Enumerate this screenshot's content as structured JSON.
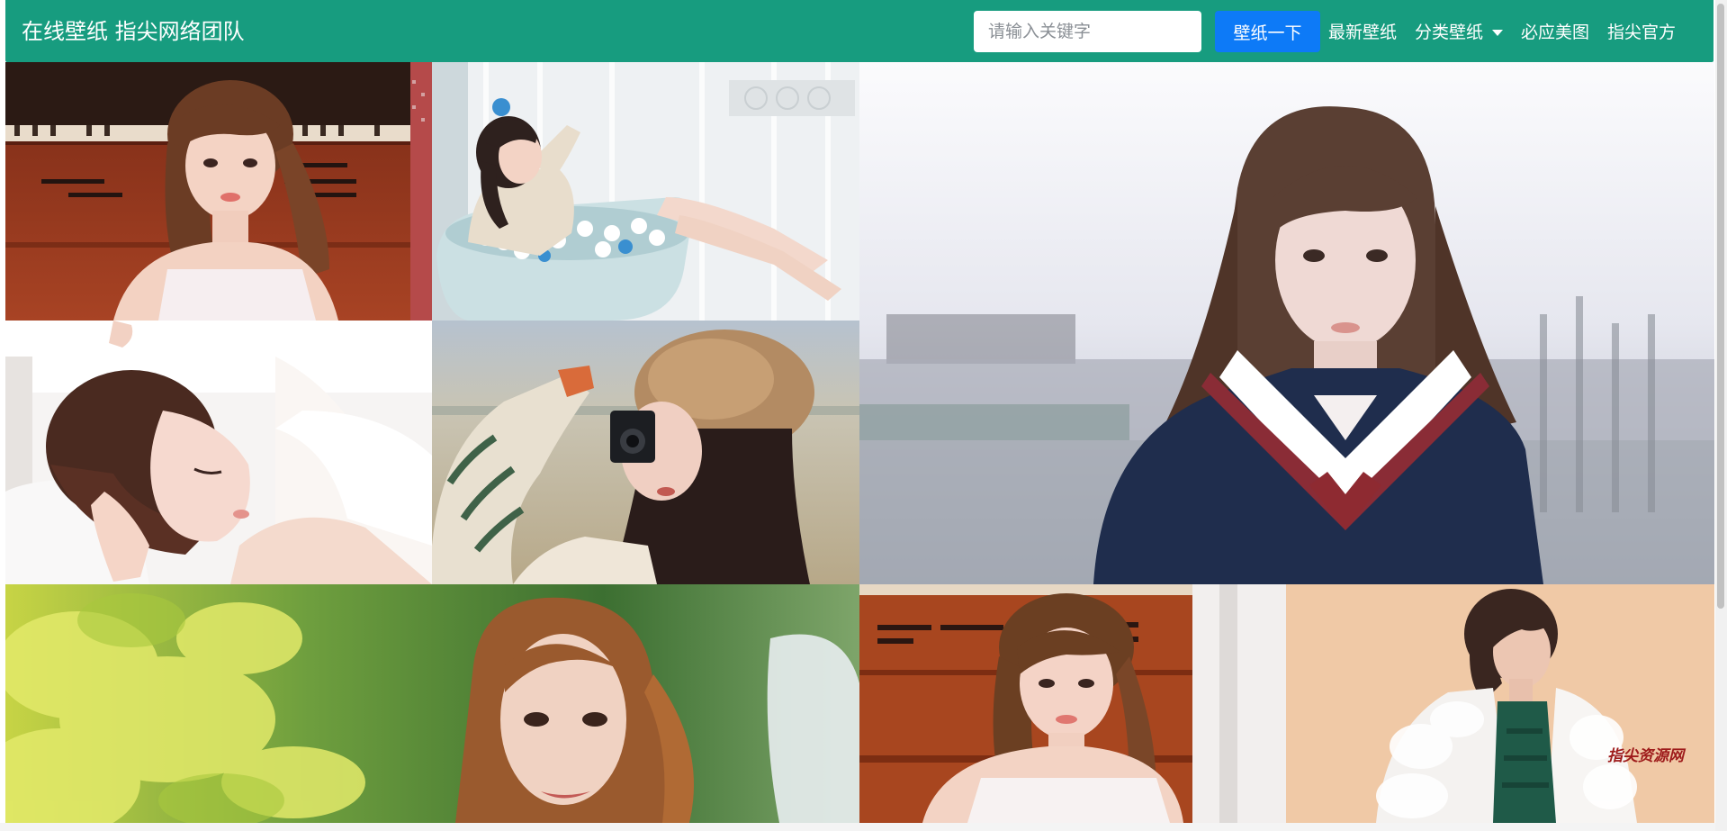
{
  "navbar": {
    "brand": "在线壁纸 指尖网络团队",
    "search_placeholder": "请输入关键字",
    "search_button": "壁纸一下",
    "links": {
      "latest": "最新壁纸",
      "category": "分类壁纸",
      "bing": "必应美图",
      "official": "指尖官方"
    },
    "color": "#179c7f",
    "button_color": "#0d7af7"
  },
  "gallery": {
    "watermark": "指尖资源网"
  }
}
